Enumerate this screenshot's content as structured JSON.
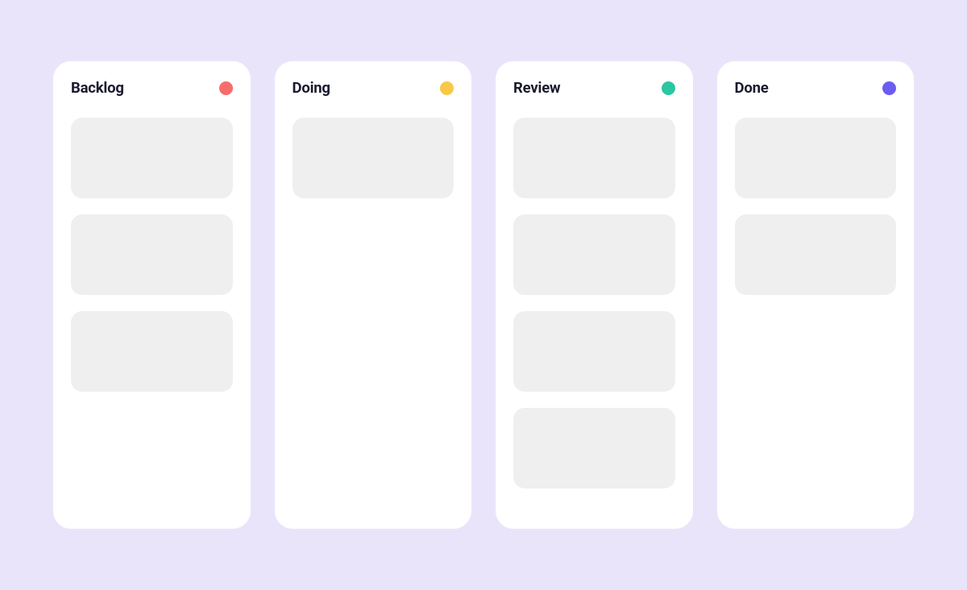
{
  "board": {
    "columns": [
      {
        "title": "Backlog",
        "status_color": "#F76C6C",
        "card_count": 3
      },
      {
        "title": "Doing",
        "status_color": "#F7C948",
        "card_count": 1
      },
      {
        "title": "Review",
        "status_color": "#2AC7A0",
        "card_count": 4
      },
      {
        "title": "Done",
        "status_color": "#6B5CF2",
        "card_count": 2
      }
    ]
  }
}
